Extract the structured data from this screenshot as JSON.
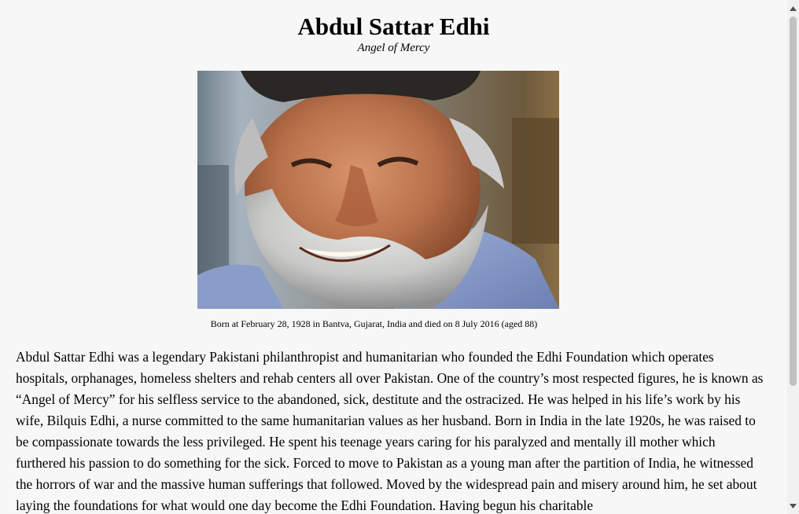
{
  "header": {
    "title": "Abdul Sattar Edhi",
    "subtitle": "Angel of Mercy"
  },
  "portrait": {
    "caption": "Born at February 28, 1928 in Bantva, Gujarat, India and died on 8 July 2016 (aged 88)"
  },
  "article": {
    "paragraph": "Abdul Sattar Edhi was a legendary Pakistani philanthropist and humanitarian who founded the Edhi Foundation which operates hospitals, orphanages, homeless shelters and rehab centers all over Pakistan. One of the country’s most respected figures, he is known as “Angel of Mercy” for his selfless service to the abandoned, sick, destitute and the ostracized. He was helped in his life’s work by his wife, Bilquis Edhi, a nurse committed to the same humanitarian values as her husband. Born in India in the late 1920s, he was raised to be compassionate towards the less privileged. He spent his teenage years caring for his paralyzed and mentally ill mother which furthered his passion to do something for the sick. Forced to move to Pakistan as a young man after the partition of India, he witnessed the horrors of war and the massive human sufferings that followed. Moved by the widespread pain and misery around him, he set about laying the foundations for what would one day become the Edhi Foundation. Having begun his charitable"
  },
  "scrollbar": {
    "up_icon": "triangle-up-icon",
    "down_icon": "triangle-down-icon"
  }
}
